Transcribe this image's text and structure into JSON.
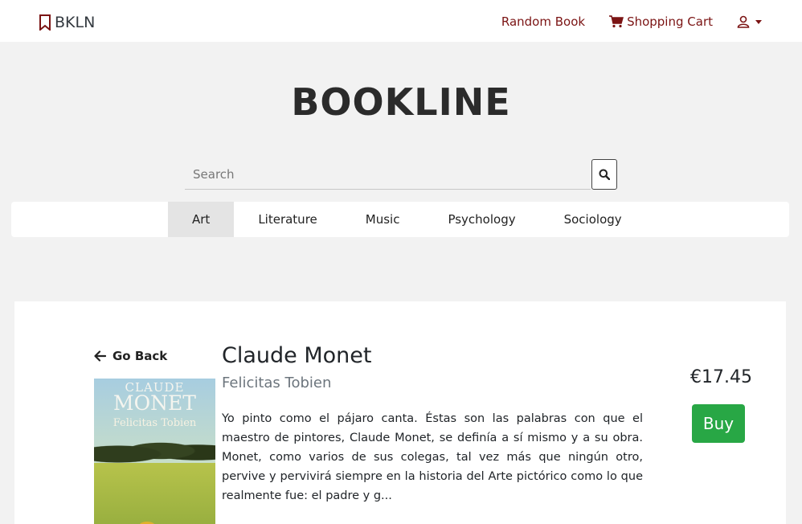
{
  "navbar": {
    "brand": "BKLN",
    "random_book": "Random Book",
    "shopping_cart": "Shopping Cart"
  },
  "hero": {
    "title": "BOOKLINE"
  },
  "search": {
    "placeholder": "Search"
  },
  "categories": [
    {
      "label": "Art",
      "active": true
    },
    {
      "label": "Literature",
      "active": false
    },
    {
      "label": "Music",
      "active": false
    },
    {
      "label": "Psychology",
      "active": false
    },
    {
      "label": "Sociology",
      "active": false
    }
  ],
  "book": {
    "go_back": "Go Back",
    "title": "Claude Monet",
    "author": "Felicitas Tobien",
    "description": "Yo pinto como el pájaro canta. Éstas son las palabras con que el maestro de pintores, Claude Monet, se definía a sí mismo y a su obra. Monet, como varios de sus colegas, tal vez más que ningún otro, pervive y pervivirá siempre en la historia del Arte pictórico como lo que realmente fue: el padre y g...",
    "price": "€17.45",
    "buy_label": "Buy",
    "cover": {
      "line1": "CLAUDE",
      "line2": "MONET",
      "line3": "Felicitas Tobien"
    }
  },
  "colors": {
    "accent": "#7b1414",
    "buy": "#28a745",
    "background": "#f2f2f2"
  }
}
